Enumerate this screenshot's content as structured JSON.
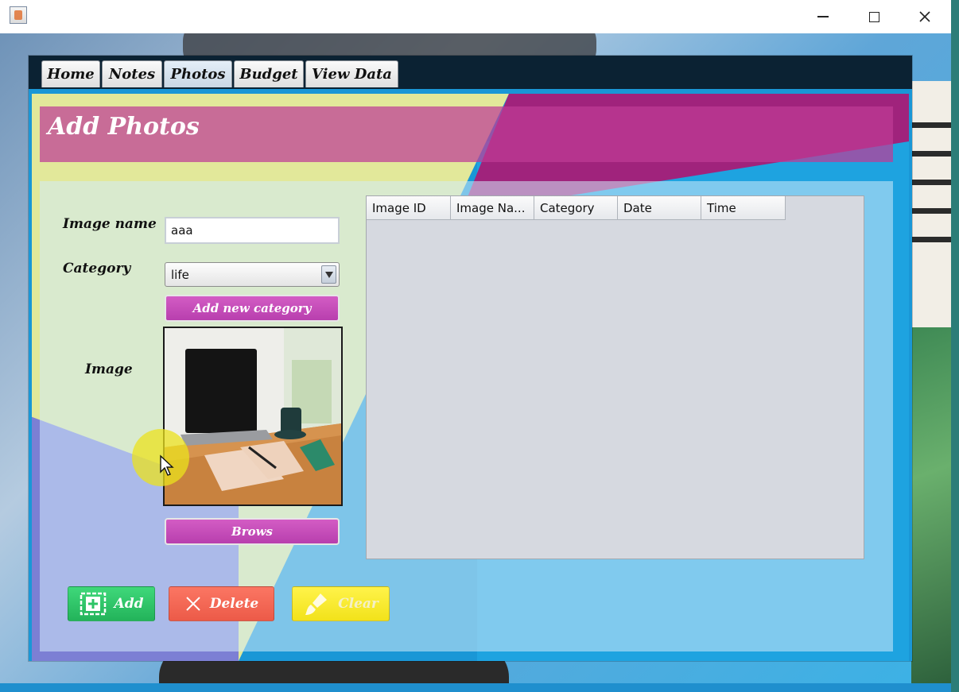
{
  "window": {
    "minimize_icon": "minimize-icon",
    "maximize_icon": "maximize-icon",
    "close_icon": "close-icon"
  },
  "tabs": [
    {
      "label": "Home"
    },
    {
      "label": "Notes"
    },
    {
      "label": "Photos"
    },
    {
      "label": "Budget"
    },
    {
      "label": "View Data"
    }
  ],
  "active_tab": "Photos",
  "page": {
    "title": "Add Photos"
  },
  "form": {
    "image_name_label": "Image name",
    "image_name_value": "aaa",
    "category_label": "Category",
    "category_value": "life",
    "add_category_button": "Add new category",
    "image_label": "Image",
    "browse_button": "Brows"
  },
  "table": {
    "columns": [
      "Image ID",
      "Image Na...",
      "Category",
      "Date",
      "Time"
    ],
    "rows": []
  },
  "actions": {
    "add": "Add",
    "delete": "Delete",
    "clear": "Clear"
  },
  "colors": {
    "add_button": "#2cc466",
    "delete_button": "#f16552",
    "clear_button": "#f7e82e",
    "pink_button": "#c24bb8",
    "header_band": "#be3c96",
    "tab_bar": "#0b2233"
  }
}
